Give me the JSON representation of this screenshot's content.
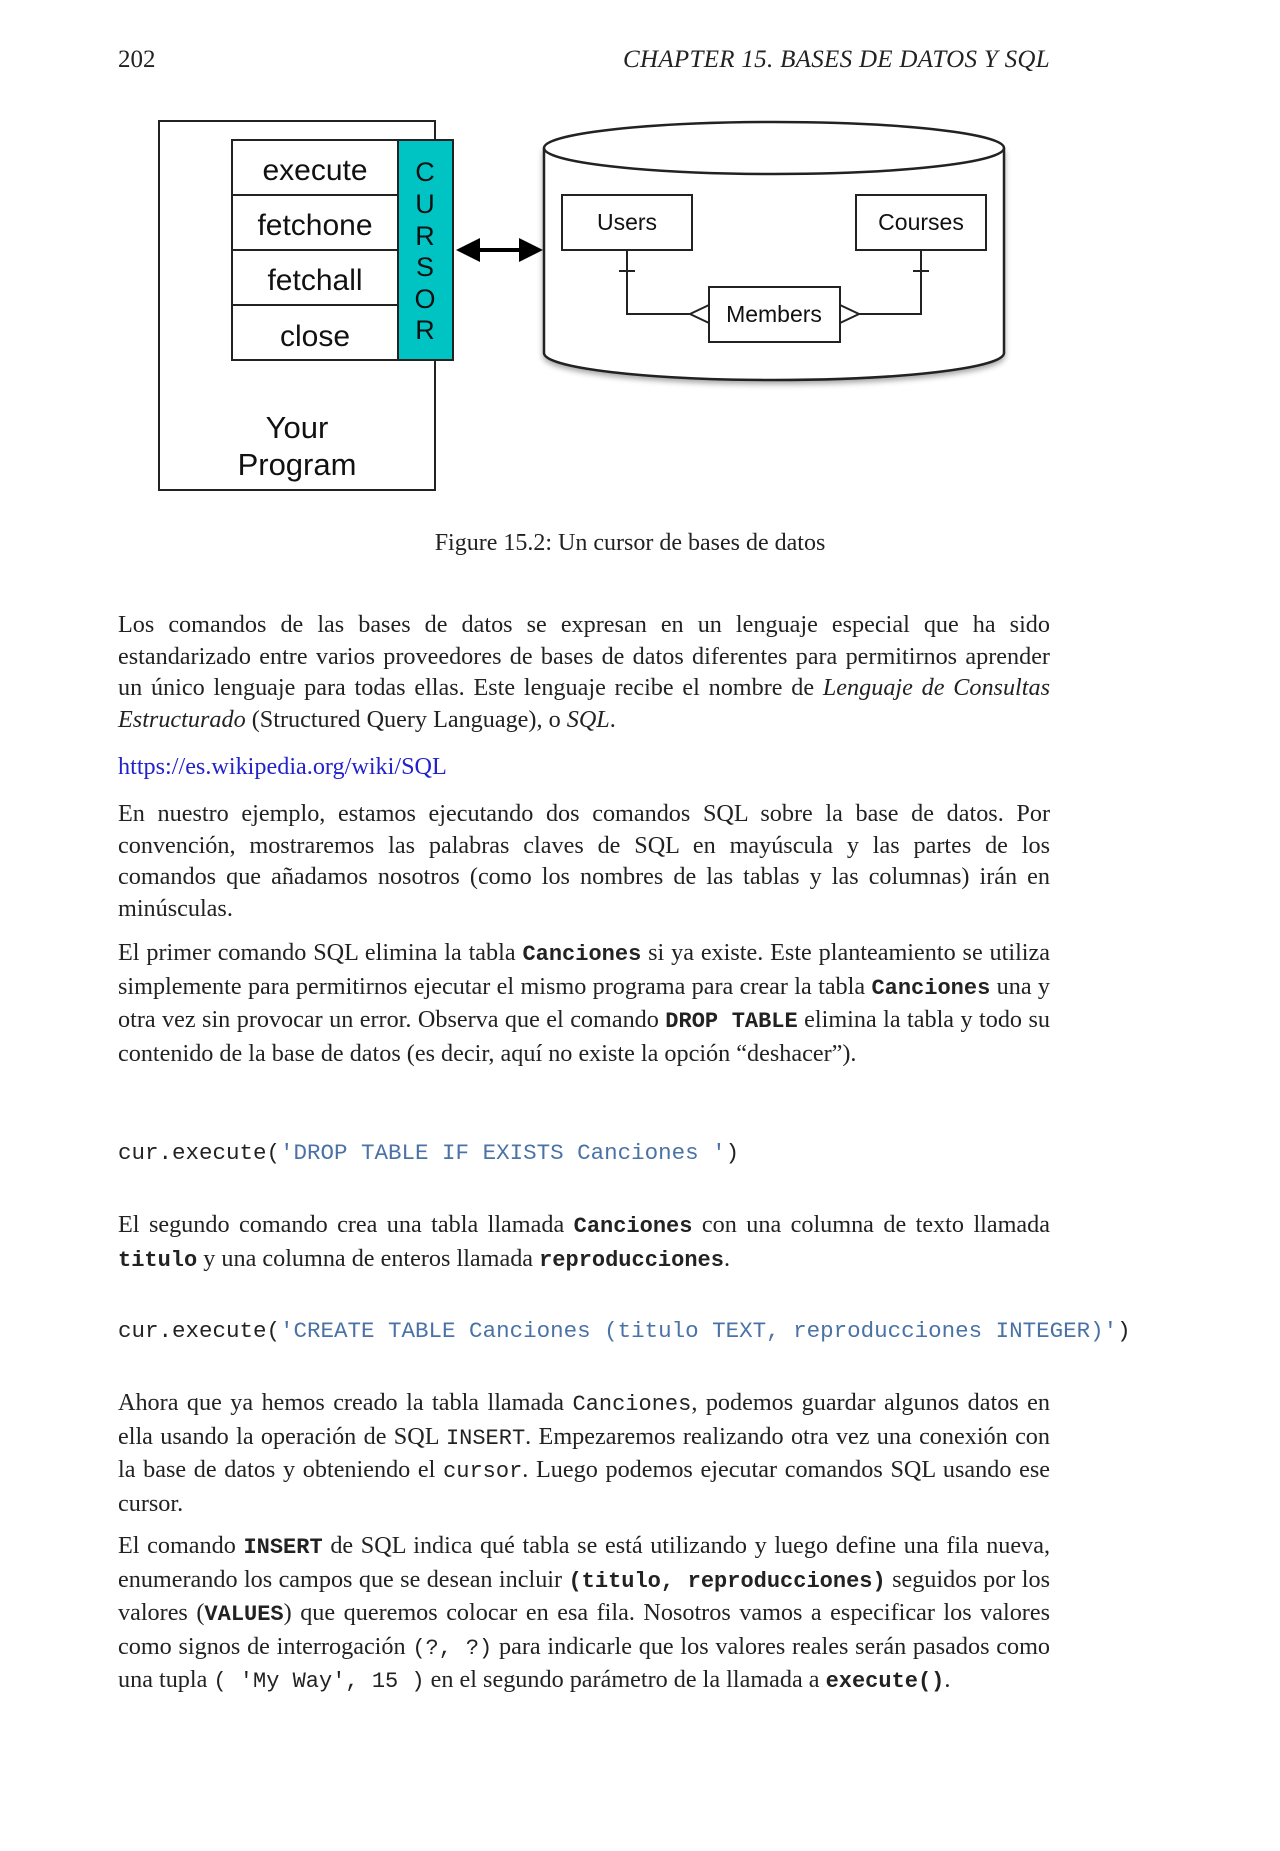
{
  "header": {
    "page_number": "202",
    "running_head": "CHAPTER 15.  BASES DE DATOS Y SQL"
  },
  "figure": {
    "program_label_line1": "Your",
    "program_label_line2": "Program",
    "methods": [
      "execute",
      "fetchone",
      "fetchall",
      "close"
    ],
    "cursor_letters": [
      "C",
      "U",
      "R",
      "S",
      "O",
      "R"
    ],
    "cursor_color": "#00c4c4",
    "tables": {
      "users": "Users",
      "courses": "Courses",
      "members": "Members"
    },
    "caption": "Figure 15.2: Un cursor de bases de datos"
  },
  "body": {
    "p1": {
      "t1": "Los comandos de las bases de datos se expresan en un lenguaje especial que ha sido estandarizado entre varios proveedores de bases de datos diferentes para permitirnos aprender un único lenguaje para todas ellas. Este lenguaje recibe el nombre de ",
      "em1": "Lenguaje de Consultas Estructurado",
      "t2": " (Structured Query Language), o ",
      "em2": "SQL",
      "t3": "."
    },
    "link": "https://es.wikipedia.org/wiki/SQL",
    "p2": "En nuestro ejemplo, estamos ejecutando dos comandos SQL sobre la base de datos. Por convención, mostraremos las palabras claves de SQL en mayúscula y las partes de los comandos que añadamos nosotros (como los nombres de las tablas y las columnas) irán en minúsculas.",
    "p3": {
      "t1": "El primer comando SQL elimina la tabla ",
      "c1": "Canciones",
      "t2": " si ya existe.  Este planteamiento se utiliza simplemente para permitirnos ejecutar el mismo programa para crear la tabla ",
      "c2": "Canciones",
      "t3": " una y otra vez sin provocar un error. Observa que el comando ",
      "c3": "DROP TABLE",
      "t4": " elimina la tabla y todo su contenido de la base de datos (es decir, aquí no existe la opción “deshacer”)."
    },
    "code1": {
      "prefix": "cur.execute(",
      "string": "'DROP TABLE IF EXISTS Canciones '",
      "suffix": ")"
    },
    "p4": {
      "t1": "El segundo comando crea una tabla llamada ",
      "c1": "Canciones",
      "t2": " con una columna de texto llamada ",
      "c2": "titulo",
      "t3": " y una columna de enteros llamada ",
      "c3": "reproducciones",
      "t4": "."
    },
    "code2": {
      "prefix": "cur.execute(",
      "string": "'CREATE TABLE Canciones (titulo TEXT, reproducciones INTEGER)'",
      "suffix": ")"
    },
    "p5": {
      "t1": "Ahora que ya hemos creado la tabla llamada ",
      "c1": "Canciones",
      "t2": ", podemos guardar algunos datos en ella usando la operación de SQL ",
      "c2": "INSERT",
      "t3": ". Empezaremos realizando otra vez una conexión con la base de datos y obteniendo el ",
      "c3": "cursor",
      "t4": ".  Luego podemos ejecutar comandos SQL usando ese cursor."
    },
    "p6": {
      "t1": "El comando ",
      "c1": "INSERT",
      "t2": " de SQL indica qué tabla se está utilizando y luego define una fila nueva, enumerando los campos que se desean incluir ",
      "c2": "(titulo, reproducciones)",
      "t3": " seguidos por los valores (",
      "c3": "VALUES",
      "t4": ") que queremos colocar en esa fila. Nosotros vamos a especificar los valores como signos de interrogación ",
      "c4": "(?, ?)",
      "t5": " para indicarle que los valores reales serán pasados como una tupla ",
      "c5": "( 'My Way', 15 )",
      "t6": " en el segundo parámetro de la llamada a ",
      "c6": "execute()",
      "t7": "."
    }
  }
}
